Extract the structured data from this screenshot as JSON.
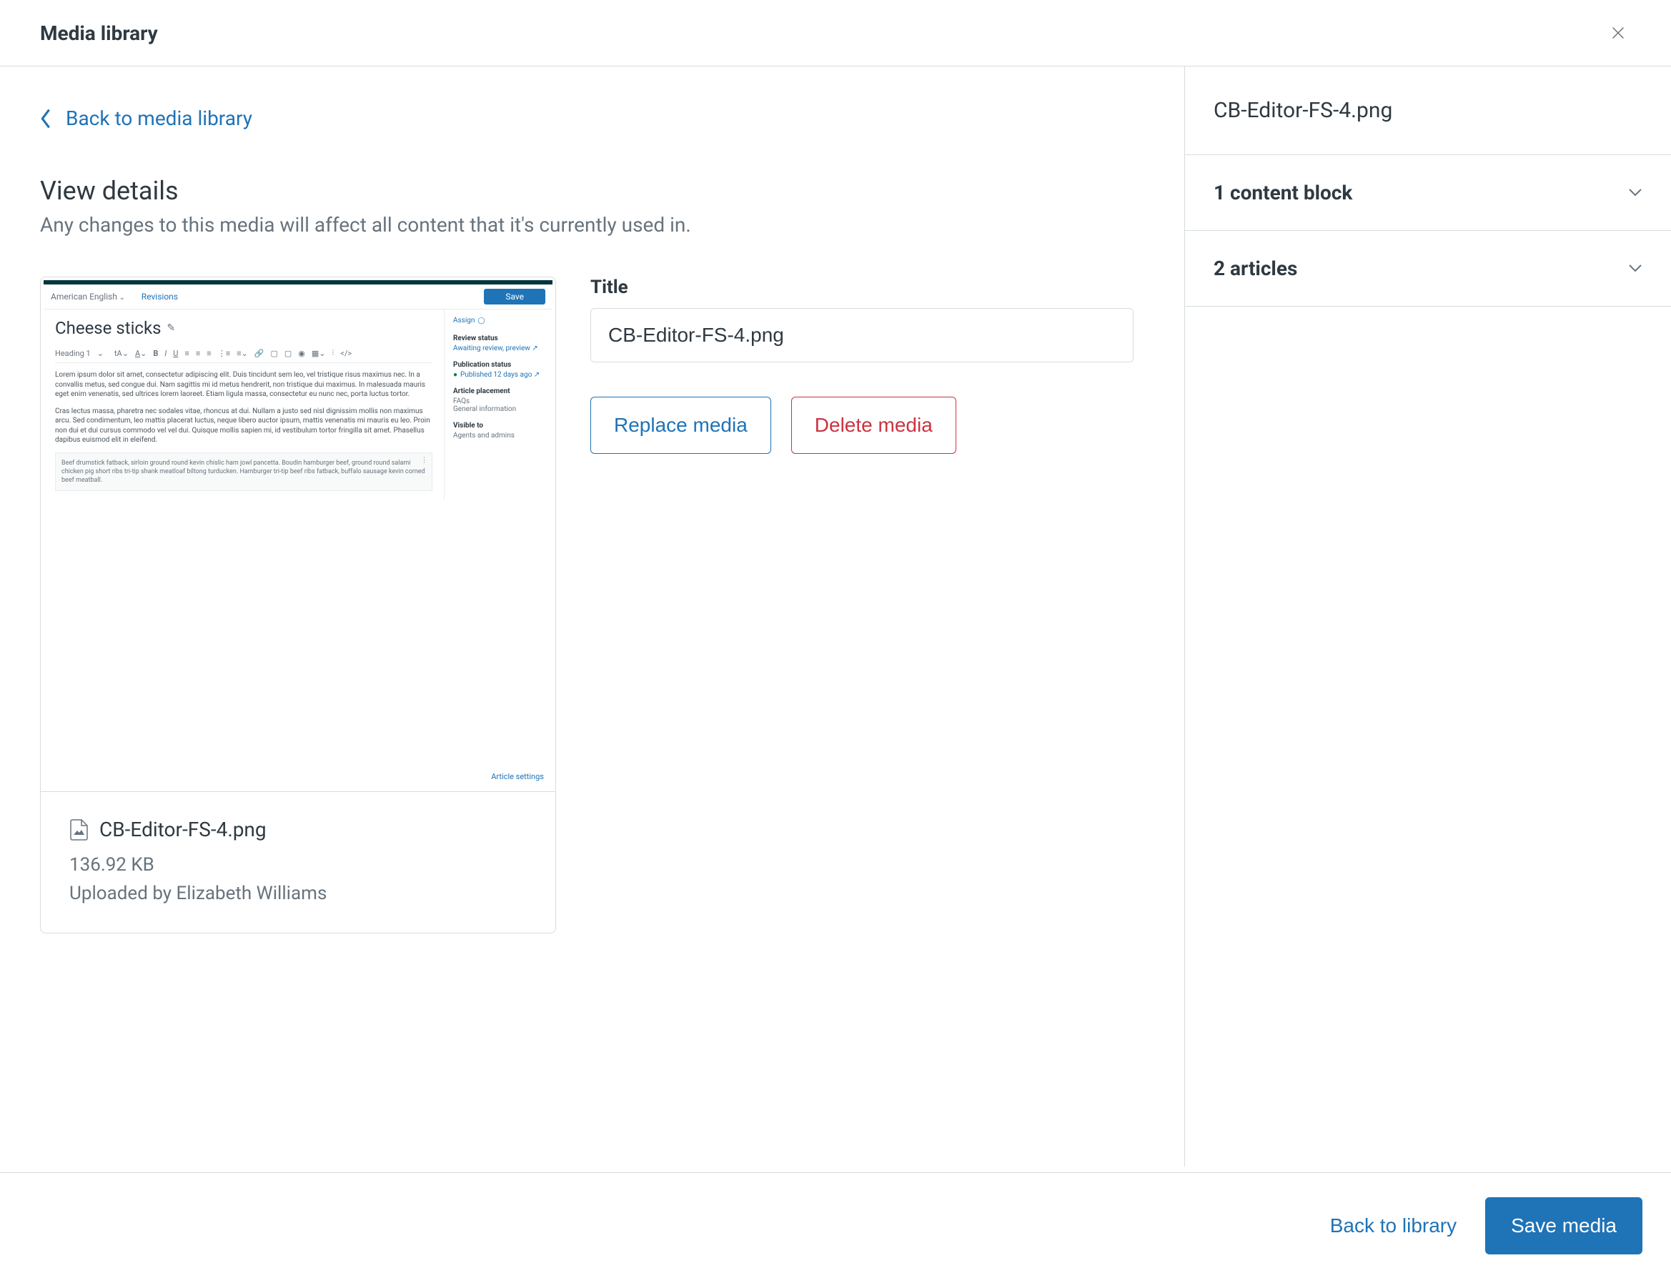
{
  "header": {
    "title": "Media library"
  },
  "back": {
    "label": "Back to media library"
  },
  "section": {
    "title": "View details",
    "subtitle": "Any changes to this media will affect all content that it's currently used in."
  },
  "media": {
    "filename": "CB-Editor-FS-4.png",
    "size": "136.92 KB",
    "uploaded_by": "Uploaded by Elizabeth Williams"
  },
  "form": {
    "title_label": "Title",
    "title_value": "CB-Editor-FS-4.png",
    "replace_label": "Replace media",
    "delete_label": "Delete media"
  },
  "sidebar": {
    "title": "CB-Editor-FS-4.png",
    "content_block_label": "1 content block",
    "articles_label": "2 articles"
  },
  "footer": {
    "back_label": "Back to library",
    "save_label": "Save media"
  },
  "preview": {
    "language": "American English",
    "revisions": "Revisions",
    "save": "Save",
    "article_title": "Cheese sticks",
    "heading_select": "Heading 1",
    "assign": "Assign",
    "review_status_h": "Review status",
    "review_status_v": "Awaiting review, preview",
    "pub_status_h": "Publication status",
    "pub_status_v": "Published 12 days ago",
    "placement_h": "Article placement",
    "placement_v1": "FAQs",
    "placement_v2": "General information",
    "visible_h": "Visible to",
    "visible_v": "Agents and admins",
    "article_settings": "Article settings",
    "para1": "Lorem ipsum dolor sit amet, consectetur adipiscing elit. Duis tincidunt sem leo, vel tristique risus maximus nec. In a convallis metus, sed congue dui. Nam sagittis mi id metus hendrerit, non tristique dui maximus. In malesuada mauris eget enim venenatis, sed ultrices lorem laoreet. Etiam ligula massa, consectetur eu nunc nec, porta luctus tortor.",
    "para2": "Cras lectus massa, pharetra nec sodales vitae, rhoncus at dui. Nullam a justo sed nisl dignissim mollis non maximus arcu. Sed condimentum, leo mattis placerat luctus, neque libero auctor ipsum, mattis venenatis mi mauris eu leo. Proin non dui et dui cursus commodo vel vel dui. Quisque mollis sapien mi, id vestibulum tortor fringilla sit amet. Phasellus dapibus euismod elit in eleifend.",
    "box": "Beef drumstick fatback, sirloin ground round kevin chislic ham jowl pancetta. Boudin hamburger beef, ground round salami chicken pig short ribs tri-tip shank meatloaf biltong turducken. Hamburger tri-tip beef ribs fatback, buffalo sausage kevin corned beef meatball."
  }
}
